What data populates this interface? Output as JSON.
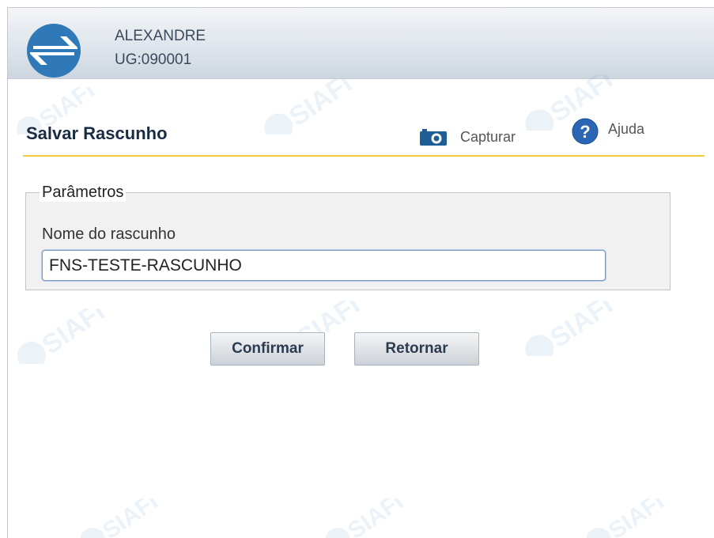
{
  "header": {
    "user_name": "ALEXANDRE",
    "user_ug": "UG:090001"
  },
  "toolbar": {
    "page_title": "Salvar Rascunho",
    "capture_label": "Capturar",
    "help_label": "Ajuda",
    "camera_icon": "camera-icon",
    "help_icon": "question-circle-icon"
  },
  "form": {
    "fieldset_legend": "Parâmetros",
    "draft_name_label": "Nome do rascunho",
    "draft_name_value": "FNS-TESTE-RASCUNHO"
  },
  "actions": {
    "confirm_label": "Confirmar",
    "return_label": "Retornar"
  },
  "colors": {
    "accent_rule": "#f2cc3c",
    "logo_blue": "#2f79b8",
    "title_text": "#1a2c44"
  }
}
